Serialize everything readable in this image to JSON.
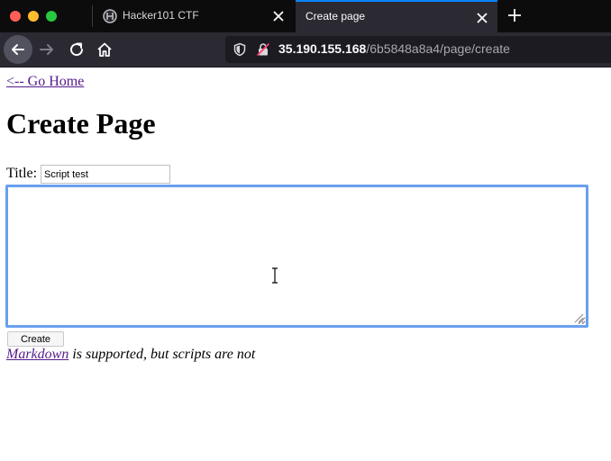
{
  "browser": {
    "tabs": [
      {
        "title": "Hacker101 CTF",
        "active": false
      },
      {
        "title": "Create page",
        "active": true
      }
    ],
    "url": {
      "host": "35.190.155.168",
      "path": "/6b5848a8a4/page/create"
    },
    "icons": [
      "back-icon",
      "forward-icon",
      "reload-icon",
      "home-icon",
      "shield-icon",
      "insecure-lock-icon",
      "close-icon",
      "plus-icon"
    ]
  },
  "page": {
    "home_link": "<-- Go Home",
    "title": "Create Page",
    "title_label": "Title:",
    "title_value": "Script test",
    "body_value": "",
    "create_label": "Create",
    "note_link": "Markdown",
    "note_text": " is supported, but scripts are not"
  },
  "colors": {
    "tab_accent": "#0a84ff",
    "visited_link": "#551a8b",
    "focus_ring": "#6aa0ee"
  }
}
